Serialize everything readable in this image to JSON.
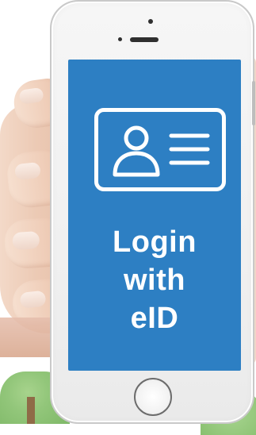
{
  "screen": {
    "text_lines": [
      "Login",
      "with",
      "eID"
    ],
    "background_color": "#2d7fc3",
    "text_color": "#ffffff"
  },
  "icons": {
    "id_card": "id-card-icon"
  }
}
